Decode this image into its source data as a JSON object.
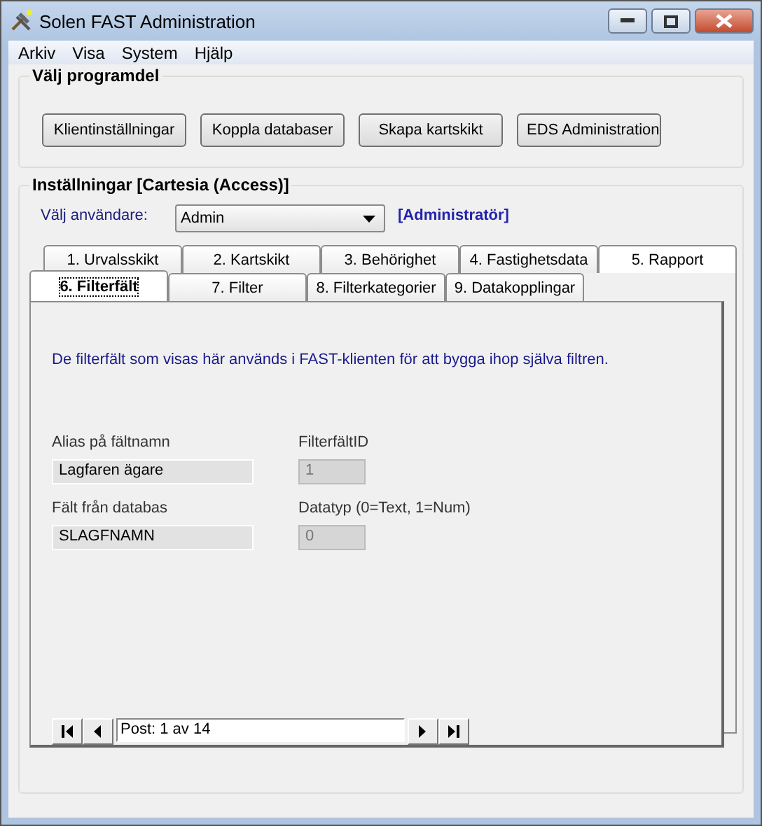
{
  "window": {
    "title": "Solen FAST Administration"
  },
  "menu": [
    "Arkiv",
    "Visa",
    "System",
    "Hjälp"
  ],
  "program_group": {
    "title": "Välj programdel",
    "buttons": [
      "Klientinställningar",
      "Koppla databaser",
      "Skapa kartskikt",
      "EDS Administration"
    ]
  },
  "settings_group": {
    "title": "Inställningar [Cartesia (Access)]",
    "user_label": "Välj användare:",
    "user_value": "Admin",
    "role": "[Administratör]",
    "tab_rows": [
      [
        {
          "label": "1. Urvalsskikt",
          "selected": false
        },
        {
          "label": "2. Kartskikt",
          "selected": false
        },
        {
          "label": "3. Behörighet",
          "selected": false
        },
        {
          "label": "4. Fastighetsdata",
          "selected": false
        },
        {
          "label": "5. Rapport",
          "selected": false
        }
      ],
      [
        {
          "label": "6. Filterfält",
          "selected": true
        },
        {
          "label": "7. Filter",
          "selected": false
        },
        {
          "label": "8. Filterkategorier",
          "selected": false
        },
        {
          "label": "9. Datakopplingar",
          "selected": false
        }
      ]
    ],
    "info": "De filterfält som visas här används i FAST-klienten för att bygga ihop själva filtren.",
    "fields": [
      {
        "label": "Alias på fältnamn",
        "value": "Lagfaren ägare",
        "disabled": false
      },
      {
        "label": "FilterfältID",
        "value": "1",
        "disabled": true
      },
      {
        "label": "Fält från databas",
        "value": "SLAGFNAMN",
        "disabled": false
      },
      {
        "label": "Datatyp (0=Text, 1=Num)",
        "value": "0",
        "disabled": true
      }
    ],
    "record": "Post: 1 av 14"
  }
}
